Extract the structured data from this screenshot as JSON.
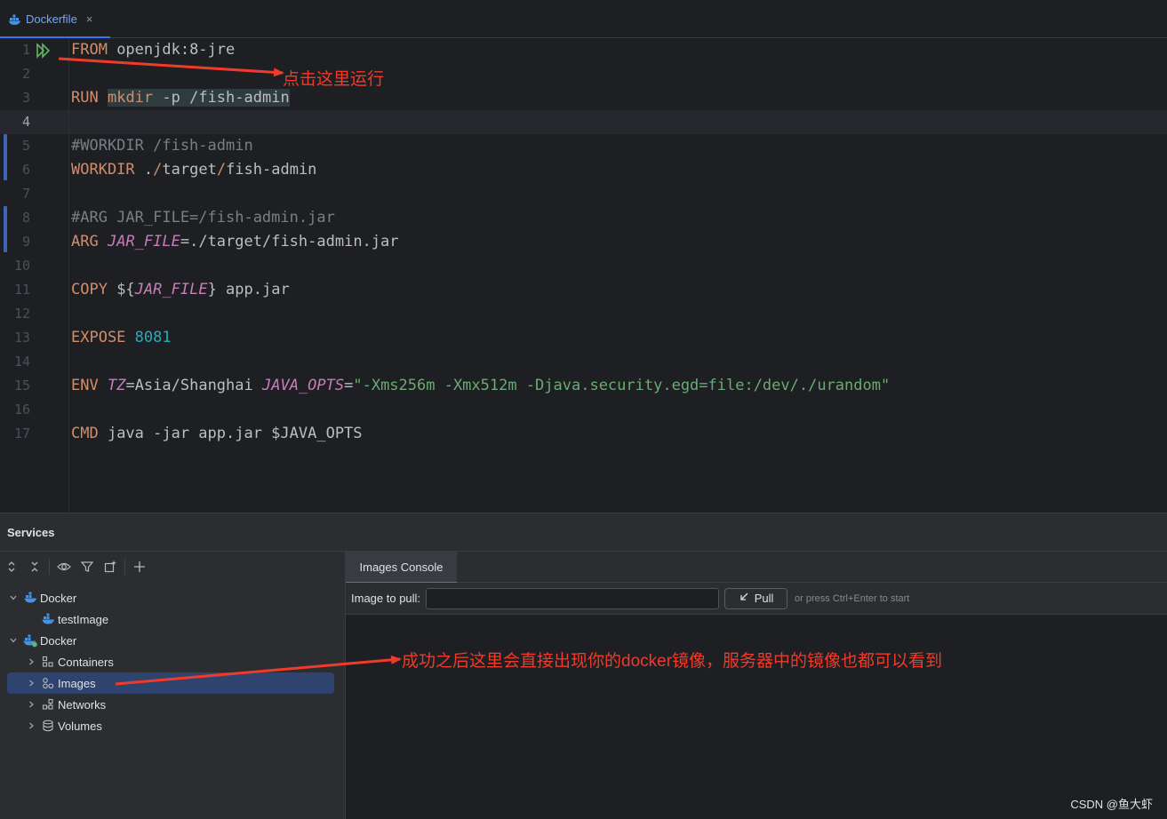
{
  "tab": {
    "label": "Dockerfile",
    "close": "×"
  },
  "editor": {
    "lines": [
      "1",
      "2",
      "3",
      "4",
      "5",
      "6",
      "7",
      "8",
      "9",
      "10",
      "11",
      "12",
      "13",
      "14",
      "15",
      "16",
      "17"
    ],
    "current_line": "4",
    "code": {
      "l1_kw": "FROM",
      "l1_rest": " openjdk:8-jre",
      "l3_kw": "RUN",
      "l3_cmd": "mkdir",
      "l3_rest": " -p /fish-admin",
      "l5": "#WORKDIR /fish-admin",
      "l6_kw": "WORKDIR",
      "l6_a": " .",
      "l6_b": "/",
      "l6_c": "target",
      "l6_d": "/",
      "l6_e": "fish-admin",
      "l8": "#ARG JAR_FILE=/fish-admin.jar",
      "l9_kw": "ARG",
      "l9_var": "JAR_FILE",
      "l9_rest": "=./target/fish-admin.jar",
      "l11_kw": "COPY",
      "l11_a": " ${",
      "l11_var": "JAR_FILE",
      "l11_b": "} app.jar",
      "l13_kw": "EXPOSE",
      "l13_num": "8081",
      "l15_kw": "ENV",
      "l15_var1": "TZ",
      "l15_a": "=Asia/Shanghai ",
      "l15_var2": "JAVA_OPTS",
      "l15_eq": "=",
      "l15_str": "\"-Xms256m -Xmx512m -Djava.security.egd=file:/dev/./urandom\"",
      "l17_kw": "CMD",
      "l17_rest": " java -jar app.jar $JAVA_OPTS"
    }
  },
  "annotations": {
    "run_hint": "点击这里运行",
    "images_hint": "成功之后这里会直接出现你的docker镜像，服务器中的镜像也都可以看到"
  },
  "services": {
    "title": "Services",
    "tree": {
      "docker1": "Docker",
      "test_image": "testImage",
      "docker2": "Docker",
      "containers": "Containers",
      "images": "Images",
      "networks": "Networks",
      "volumes": "Volumes"
    },
    "console": {
      "tab": "Images Console",
      "pull_label": "Image to pull:",
      "pull_value": "",
      "pull_button": "Pull",
      "pull_hint": "or press Ctrl+Enter to start"
    }
  },
  "watermark": "CSDN @鱼大虾",
  "colors": {
    "accent": "#3574f0",
    "annotation": "#f03a2a",
    "keyword": "#cf8e6d",
    "string": "#6aab73",
    "number": "#2aacb8",
    "variable": "#c77dbb"
  }
}
